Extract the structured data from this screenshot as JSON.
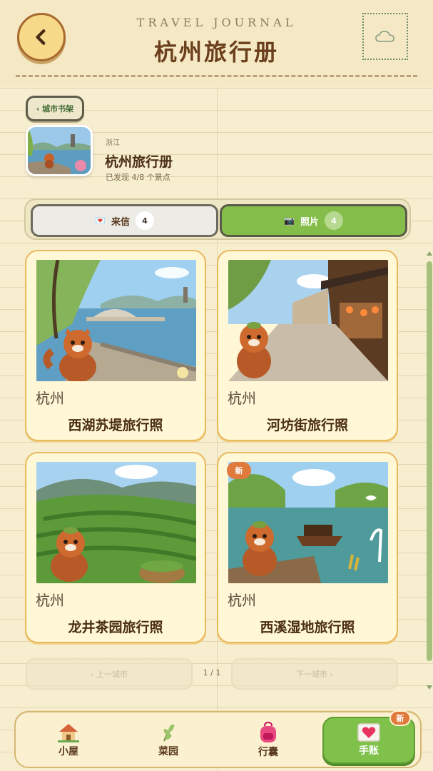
{
  "header": {
    "subtitle": "TRAVEL JOURNAL",
    "title": "杭州旅行册",
    "back_icon": "chevron-left-icon",
    "stamp_icon": "cloud-icon"
  },
  "city": {
    "shelf_label": "‹ 城市书架",
    "province": "浙江",
    "name": "杭州旅行册",
    "discovered": "已发现 4/8 个景点"
  },
  "tabs": [
    {
      "icon": "💌",
      "label": "来信",
      "count": "4",
      "active": false
    },
    {
      "icon": "📷",
      "label": "照片",
      "count": "4",
      "active": true
    }
  ],
  "cards": [
    {
      "city": "杭州",
      "caption": "西湖苏堤旅行照",
      "is_new": false
    },
    {
      "city": "杭州",
      "caption": "河坊街旅行照",
      "is_new": false
    },
    {
      "city": "杭州",
      "caption": "龙井茶园旅行照",
      "is_new": false
    },
    {
      "city": "杭州",
      "caption": "西溪湿地旅行照",
      "is_new": true,
      "badge": "新"
    }
  ],
  "pager": {
    "prev_label": "‹ 上一城市",
    "page": "1 / 1",
    "next_label": "下一城市 ›"
  },
  "nav": {
    "items": [
      {
        "label": "小屋",
        "icon": "house-icon"
      },
      {
        "label": "菜园",
        "icon": "sprout-icon"
      },
      {
        "label": "行囊",
        "icon": "backpack-icon"
      },
      {
        "label": "手账",
        "icon": "journal-heart-icon",
        "active": true
      }
    ],
    "badge": "新"
  },
  "colors": {
    "accent_green": "#85bd4a",
    "card_border": "#e8b85b",
    "new_badge": "#e07a3c",
    "title_brown": "#6b3f1c"
  }
}
